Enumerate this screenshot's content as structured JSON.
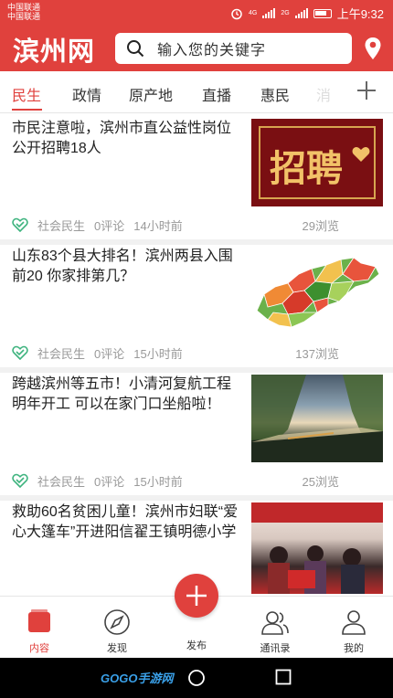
{
  "status": {
    "carrier1": "中国联通",
    "carrier2": "中国联通",
    "net1": "4G",
    "net2": "2G",
    "time": "上午9:32"
  },
  "header": {
    "logo": "滨州网",
    "search_placeholder": "输入您的关键字",
    "accent": "#e0413d"
  },
  "tabs": [
    {
      "label": "民生",
      "active": true
    },
    {
      "label": "政情"
    },
    {
      "label": "原产地"
    },
    {
      "label": "直播"
    },
    {
      "label": "惠民"
    },
    {
      "label": "消"
    }
  ],
  "news": [
    {
      "title": "市民注意啦，滨州市直公益性岗位公开招聘18人",
      "category": "社会民生",
      "comments": "0评论",
      "time": "14小时前",
      "views": "29浏览",
      "thumb_text": "招聘"
    },
    {
      "title": "山东83个县大排名！滨州两县入围前20 你家排第几？",
      "category": "社会民生",
      "comments": "0评论",
      "time": "15小时前",
      "views": "137浏览"
    },
    {
      "title": "跨越滨州等五市！小清河复航工程明年开工 可以在家门口坐船啦！",
      "category": "社会民生",
      "comments": "0评论",
      "time": "15小时前",
      "views": "25浏览"
    },
    {
      "title": "救助60名贫困儿童！滨州市妇联“爱心大篷车”开进阳信翟王镇明德小学",
      "category": "",
      "comments": "",
      "time": "",
      "views": ""
    }
  ],
  "bottom_nav": {
    "content": "内容",
    "discover": "发现",
    "publish": "发布",
    "contacts": "通讯录",
    "mine": "我的"
  },
  "watermark": "GOGO手游网"
}
